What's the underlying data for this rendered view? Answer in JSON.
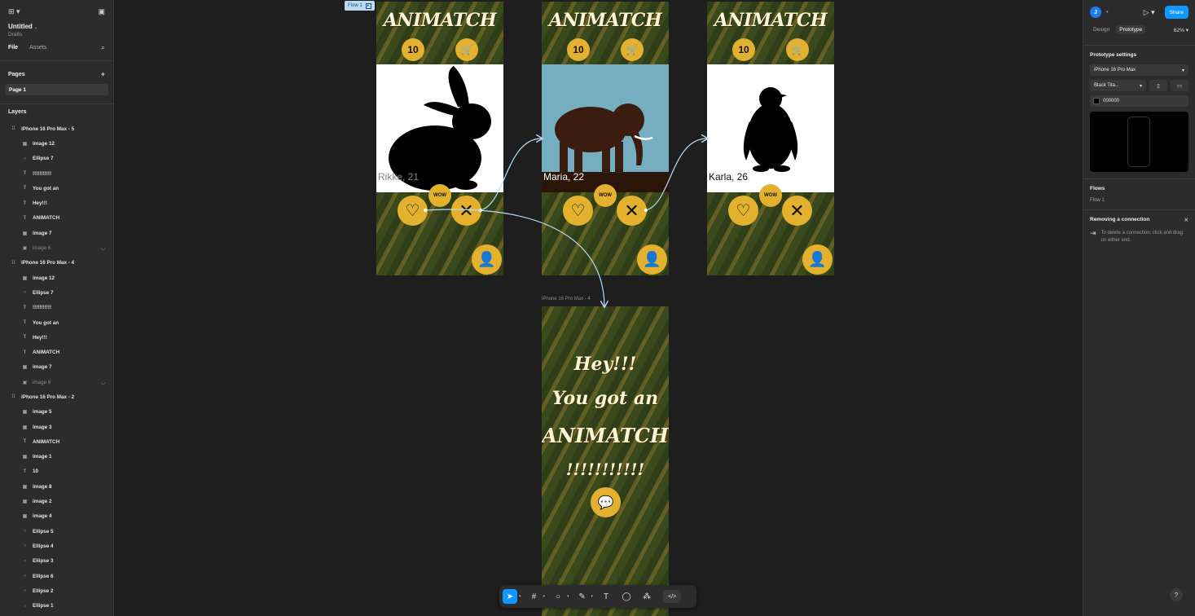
{
  "left_panel": {
    "file_name": "Untitled",
    "file_location": "Drafts",
    "tabs": [
      "File",
      "Assets"
    ],
    "pages_label": "Pages",
    "pages": [
      "Page 1"
    ],
    "layers_label": "Layers",
    "layers": [
      {
        "name": "iPhone 16 Pro Max - 5",
        "kind": "frame"
      },
      {
        "name": "image 12",
        "kind": "image"
      },
      {
        "name": "Ellipse 7",
        "kind": "ellipse"
      },
      {
        "name": "!!!!!!!!!!!",
        "kind": "text"
      },
      {
        "name": "You got an",
        "kind": "text"
      },
      {
        "name": "Hey!!!",
        "kind": "text"
      },
      {
        "name": "ANIMATCH",
        "kind": "text"
      },
      {
        "name": "image 7",
        "kind": "image"
      },
      {
        "name": "image 6",
        "kind": "image",
        "hidden": true
      },
      {
        "name": "iPhone 16 Pro Max - 4",
        "kind": "frame"
      },
      {
        "name": "image 12",
        "kind": "image"
      },
      {
        "name": "Ellipse 7",
        "kind": "ellipse"
      },
      {
        "name": "!!!!!!!!!!!",
        "kind": "text"
      },
      {
        "name": "You got an",
        "kind": "text"
      },
      {
        "name": "Hey!!!",
        "kind": "text"
      },
      {
        "name": "ANIMATCH",
        "kind": "text"
      },
      {
        "name": "image 7",
        "kind": "image"
      },
      {
        "name": "image 6",
        "kind": "image",
        "hidden": true
      },
      {
        "name": "iPhone 16 Pro Max - 2",
        "kind": "frame"
      },
      {
        "name": "image 5",
        "kind": "image"
      },
      {
        "name": "image 3",
        "kind": "image"
      },
      {
        "name": "ANIMATCH",
        "kind": "text"
      },
      {
        "name": "image 1",
        "kind": "image"
      },
      {
        "name": "10",
        "kind": "text"
      },
      {
        "name": "image 8",
        "kind": "image"
      },
      {
        "name": "image 2",
        "kind": "image"
      },
      {
        "name": "image 4",
        "kind": "image"
      },
      {
        "name": "Ellipse 5",
        "kind": "ellipse"
      },
      {
        "name": "Ellipse 4",
        "kind": "ellipse"
      },
      {
        "name": "Ellipse 3",
        "kind": "ellipse"
      },
      {
        "name": "Ellipse 6",
        "kind": "ellipse"
      },
      {
        "name": "Ellipse 2",
        "kind": "ellipse"
      },
      {
        "name": "Ellipse 1",
        "kind": "ellipse"
      }
    ]
  },
  "canvas": {
    "flow_badge": "Flow 1",
    "frame_label": "iPhone 16 Pro Max - 4",
    "brand": "ANIMATCH",
    "cards": [
      {
        "name": "Rikke, 21",
        "animal": "rabbit",
        "bg": "#ffffff"
      },
      {
        "name": "Maria, 22",
        "animal": "elephant",
        "bg": "#74aec0"
      },
      {
        "name": "Karla, 26",
        "animal": "penguin",
        "bg": "#ffffff"
      }
    ],
    "match_screen": {
      "line1": "Hey!!!",
      "line2": "You got an",
      "line3": "ANIMATCH",
      "line4": "!!!!!!!!!!!"
    },
    "accent_color": "#e3b12d"
  },
  "right_panel": {
    "avatar_initial": "J",
    "share_label": "Share",
    "tabs": [
      "Design",
      "Prototype"
    ],
    "zoom": "62%",
    "prototype_settings_label": "Prototype settings",
    "device": "iPhone 16 Pro Max",
    "model": "Black Tita...",
    "background_hex": "000000",
    "flows_label": "Flows",
    "flow_item": "Flow 1",
    "removing_title": "Removing a connection",
    "removing_hint": "To delete a connection, click and drag on either end."
  }
}
